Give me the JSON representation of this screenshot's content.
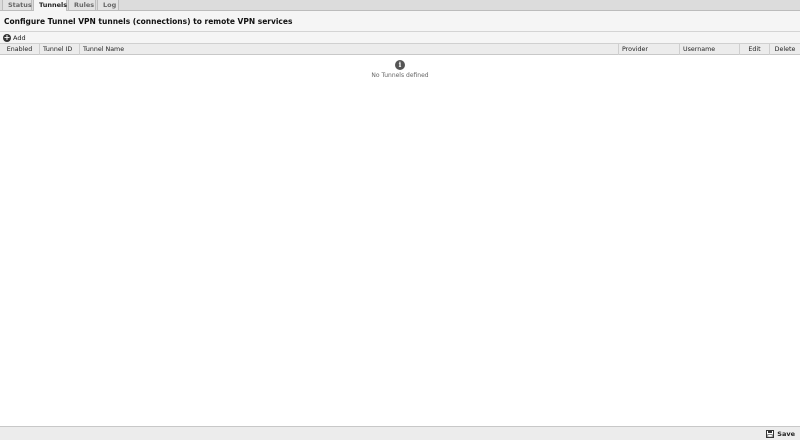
{
  "tabs": [
    {
      "label": "Status"
    },
    {
      "label": "Tunnels"
    },
    {
      "label": "Rules"
    },
    {
      "label": "Log"
    }
  ],
  "active_tab": "Tunnels",
  "page_title": "Configure Tunnel VPN tunnels (connections) to remote VPN services",
  "toolbar": {
    "add_label": "Add",
    "add_icon": "plus-circle-icon"
  },
  "grid": {
    "columns": [
      "Enabled",
      "Tunnel ID",
      "Tunnel Name",
      "Provider",
      "Username",
      "Edit",
      "Delete"
    ],
    "rows": [],
    "empty_icon": "info-icon",
    "empty_message": "No Tunnels defined"
  },
  "footer": {
    "save_label": "Save",
    "save_icon": "floppy-disk-icon"
  }
}
